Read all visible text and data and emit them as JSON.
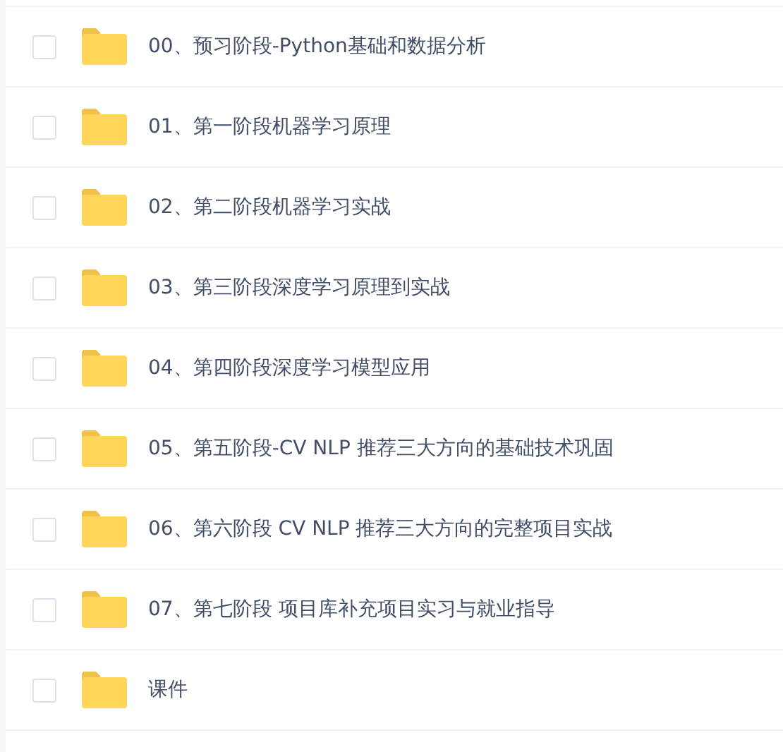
{
  "files": [
    {
      "name": "00、预习阶段-Python基础和数据分析",
      "checked": false
    },
    {
      "name": "01、第一阶段机器学习原理",
      "checked": false
    },
    {
      "name": "02、第二阶段机器学习实战",
      "checked": false
    },
    {
      "name": "03、第三阶段深度学习原理到实战",
      "checked": false
    },
    {
      "name": "04、第四阶段深度学习模型应用",
      "checked": false
    },
    {
      "name": "05、第五阶段-CV NLP 推荐三大方向的基础技术巩固",
      "checked": false
    },
    {
      "name": "06、第六阶段 CV NLP 推荐三大方向的完整项目实战",
      "checked": false
    },
    {
      "name": "07、第七阶段 项目库补充项目实习与就业指导",
      "checked": false
    },
    {
      "name": "课件",
      "checked": false
    }
  ]
}
